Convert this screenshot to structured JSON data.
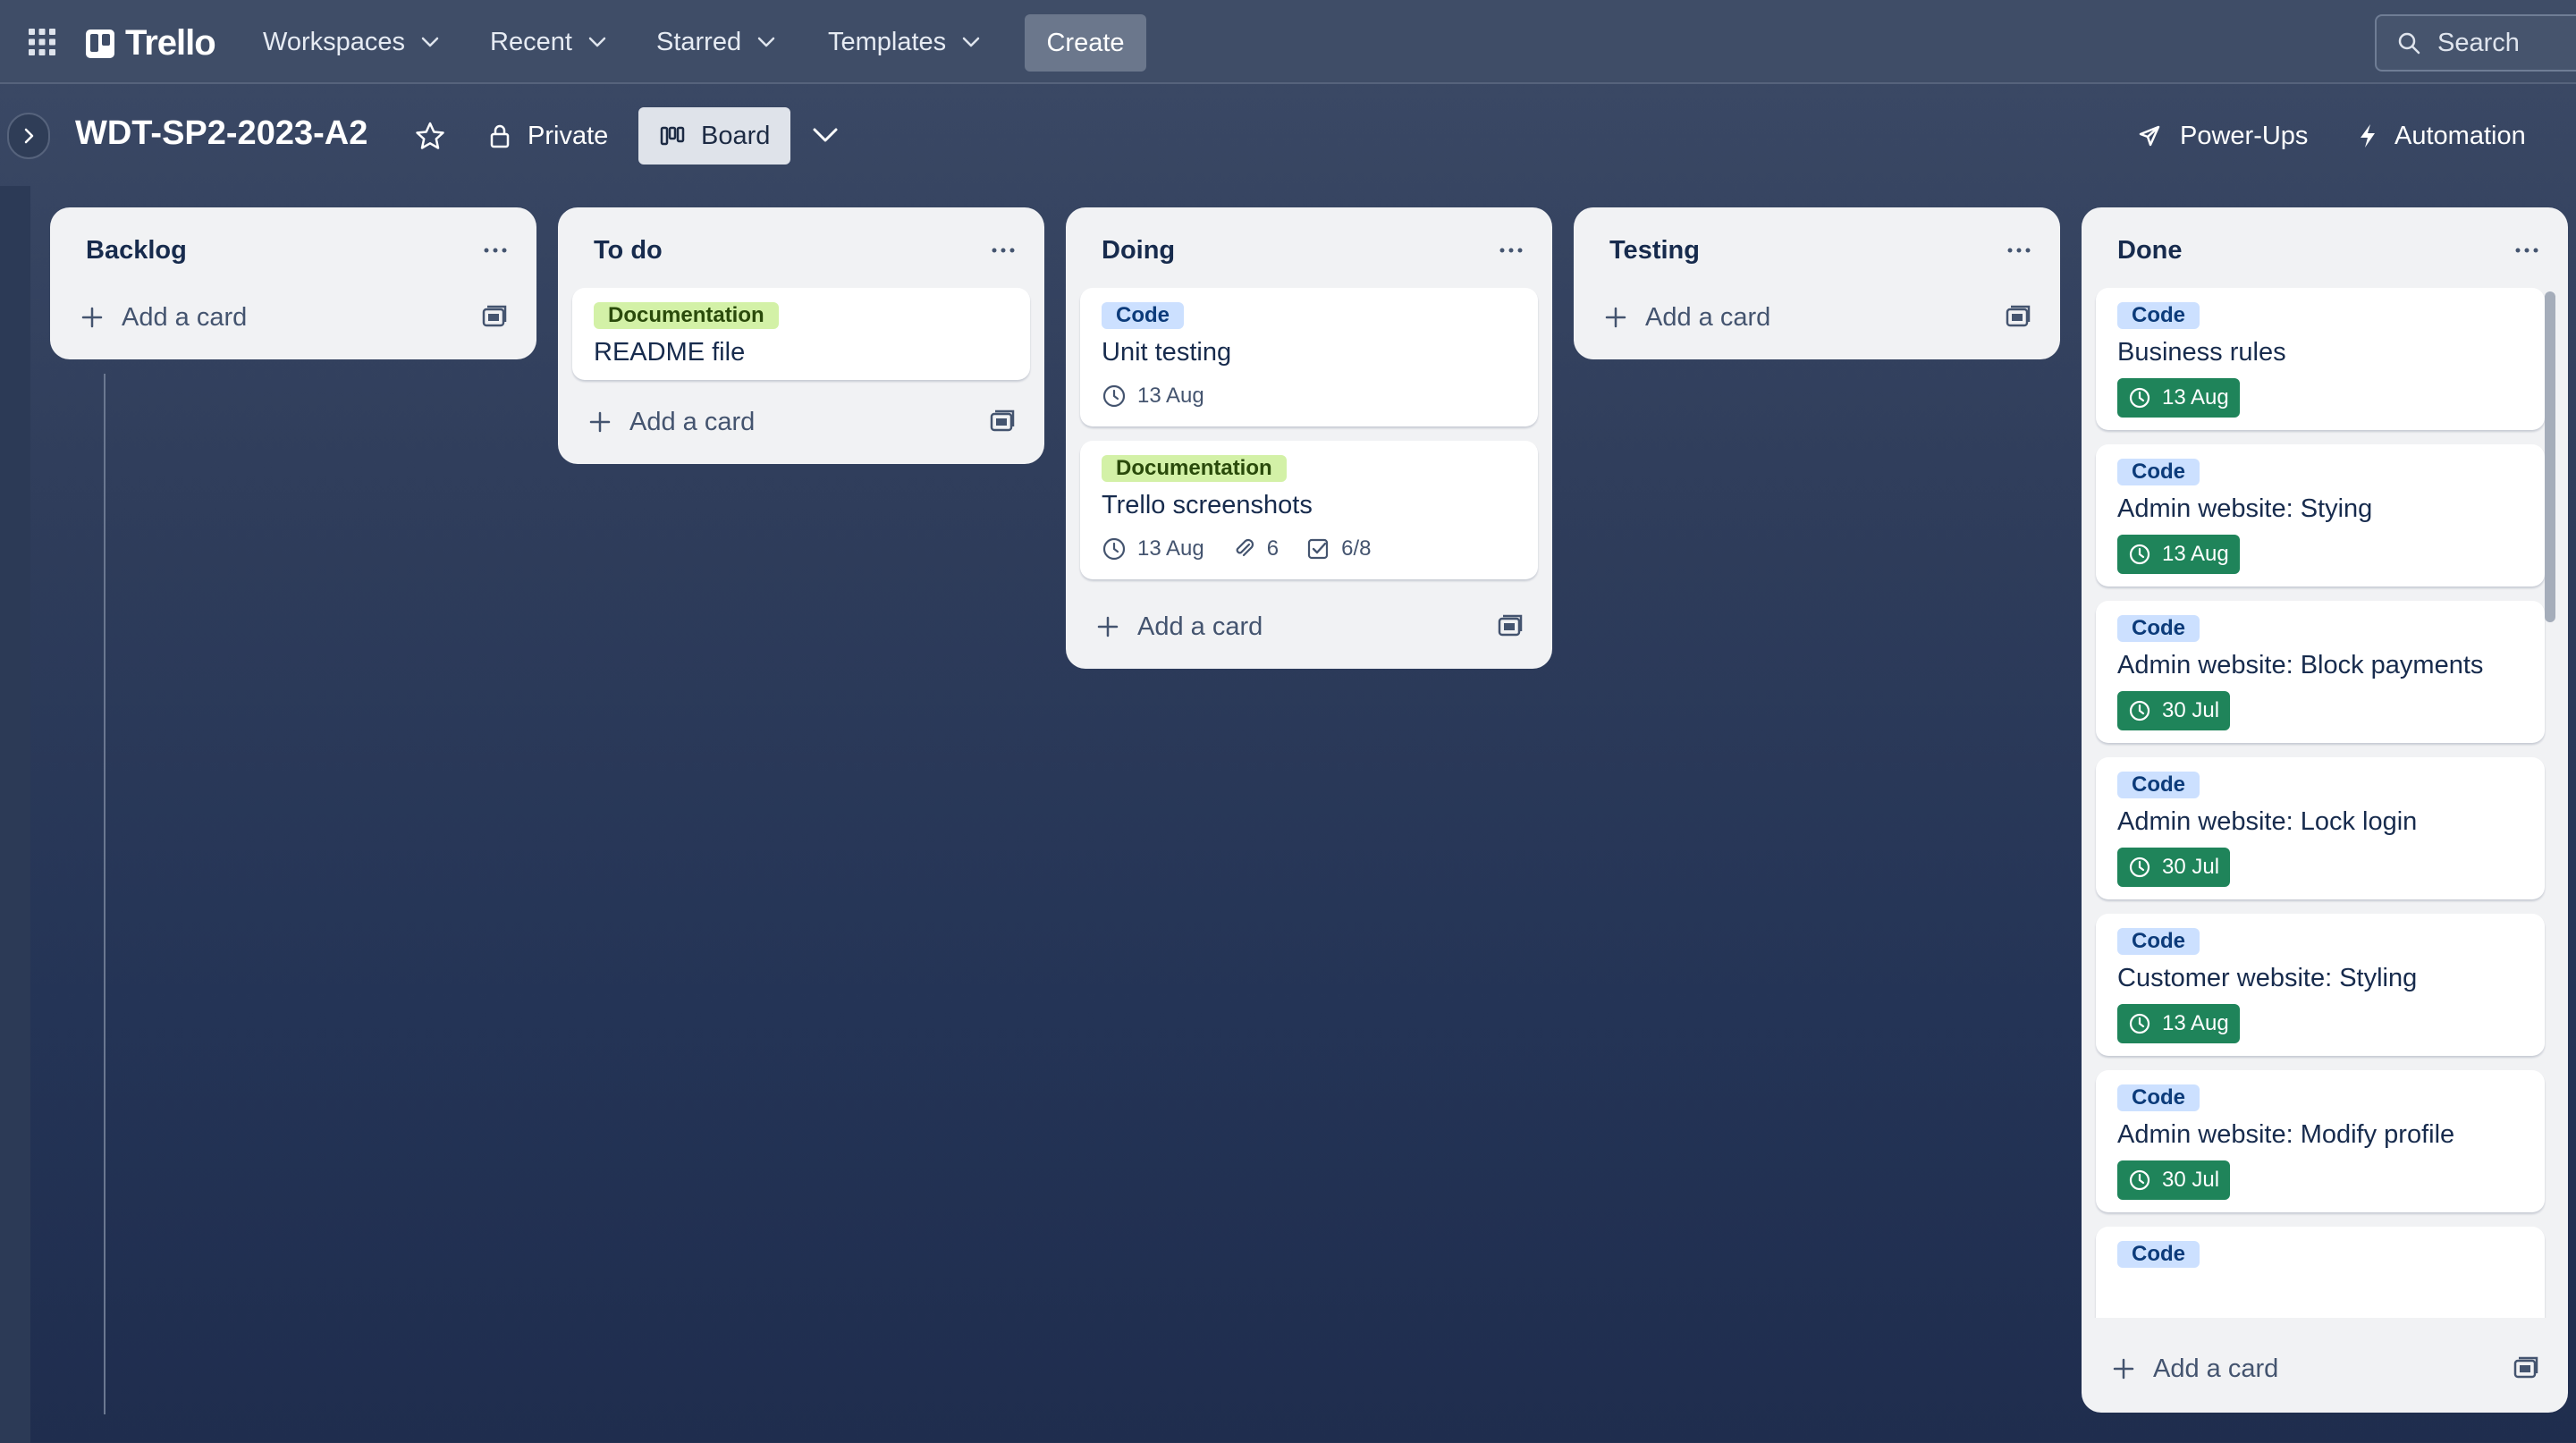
{
  "topnav": {
    "brand": "Trello",
    "menus": [
      {
        "label": "Workspaces"
      },
      {
        "label": "Recent"
      },
      {
        "label": "Starred"
      },
      {
        "label": "Templates"
      }
    ],
    "create_label": "Create",
    "search_placeholder": "Search"
  },
  "board": {
    "title": "WDT-SP2-2023-A2",
    "visibility": "Private",
    "view": "Board",
    "powerups_label": "Power-Ups",
    "automation_label": "Automation"
  },
  "add_card_label": "Add a card",
  "lists": [
    {
      "title": "Backlog",
      "cards": []
    },
    {
      "title": "To do",
      "cards": [
        {
          "label": "Documentation",
          "label_type": "doc",
          "title": "README file"
        }
      ]
    },
    {
      "title": "Doing",
      "cards": [
        {
          "label": "Code",
          "label_type": "code",
          "title": "Unit testing",
          "due": "13 Aug"
        },
        {
          "label": "Documentation",
          "label_type": "doc",
          "title": "Trello screenshots",
          "due": "13 Aug",
          "attachments": "6",
          "checklist": "6/8"
        }
      ]
    },
    {
      "title": "Testing",
      "cards": []
    },
    {
      "title": "Done",
      "cards": [
        {
          "label": "Code",
          "label_type": "code",
          "title": "Business rules",
          "due": "13 Aug",
          "due_complete": true
        },
        {
          "label": "Code",
          "label_type": "code",
          "title": "Admin website: Stying",
          "due": "13 Aug",
          "due_complete": true
        },
        {
          "label": "Code",
          "label_type": "code",
          "title": "Admin website: Block payments",
          "due": "30 Jul",
          "due_complete": true
        },
        {
          "label": "Code",
          "label_type": "code",
          "title": "Admin website: Lock login",
          "due": "30 Jul",
          "due_complete": true
        },
        {
          "label": "Code",
          "label_type": "code",
          "title": "Customer website: Styling",
          "due": "13 Aug",
          "due_complete": true
        },
        {
          "label": "Code",
          "label_type": "code",
          "title": "Admin website: Modify profile",
          "due": "30 Jul",
          "due_complete": true
        },
        {
          "label": "Code",
          "label_type": "code"
        }
      ]
    }
  ],
  "colors": {
    "label_code": "#cce0ff",
    "label_documentation": "#d3f1a7",
    "due_complete": "#1f845a",
    "list_bg": "#f1f2f4"
  }
}
